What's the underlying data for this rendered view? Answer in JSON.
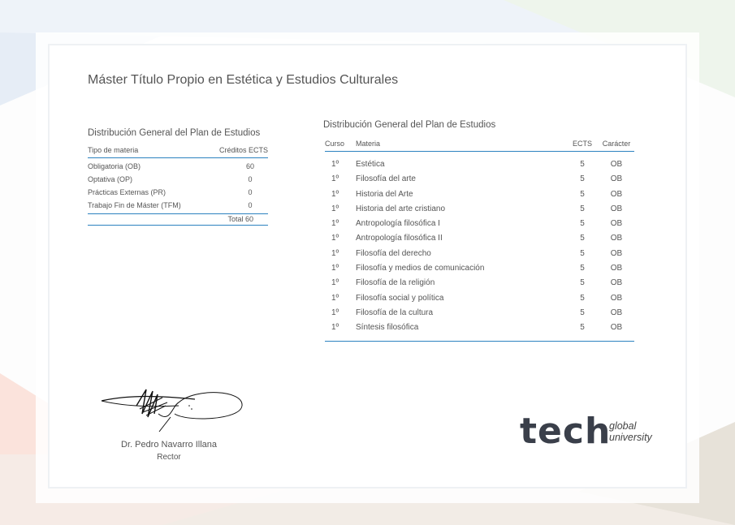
{
  "certificate_title": "Máster Título Propio en Estética y Estudios Culturales",
  "summary": {
    "title": "Distribución General del Plan de Estudios",
    "headers": {
      "type": "Tipo de materia",
      "credits": "Créditos ECTS"
    },
    "rows": [
      {
        "label": "Obligatoria (OB)",
        "value": "60"
      },
      {
        "label": "Optativa (OP)",
        "value": "0"
      },
      {
        "label": "Prácticas Externas (PR)",
        "value": "0"
      },
      {
        "label": "Trabajo Fin de Máster (TFM)",
        "value": "0"
      }
    ],
    "total": "Total 60"
  },
  "detail": {
    "title": "Distribución General del Plan de Estudios",
    "headers": {
      "course": "Curso",
      "subject": "Materia",
      "ects": "ECTS",
      "character": "Carácter"
    },
    "rows": [
      {
        "course": "1º",
        "subject": "Estética",
        "ects": "5",
        "character": "OB"
      },
      {
        "course": "1º",
        "subject": "Filosofía del arte",
        "ects": "5",
        "character": "OB"
      },
      {
        "course": "1º",
        "subject": "Historia del Arte",
        "ects": "5",
        "character": "OB"
      },
      {
        "course": "1º",
        "subject": "Historia del arte cristiano",
        "ects": "5",
        "character": "OB"
      },
      {
        "course": "1º",
        "subject": "Antropología filosófica I",
        "ects": "5",
        "character": "OB"
      },
      {
        "course": "1º",
        "subject": "Antropología filosófica II",
        "ects": "5",
        "character": "OB"
      },
      {
        "course": "1º",
        "subject": "Filosofía del derecho",
        "ects": "5",
        "character": "OB"
      },
      {
        "course": "1º",
        "subject": "Filosofía y medios de comunicación",
        "ects": "5",
        "character": "OB"
      },
      {
        "course": "1º",
        "subject": "Filosofía de la religión",
        "ects": "5",
        "character": "OB"
      },
      {
        "course": "1º",
        "subject": "Filosofía social y política",
        "ects": "5",
        "character": "OB"
      },
      {
        "course": "1º",
        "subject": "Filosofía de la cultura",
        "ects": "5",
        "character": "OB"
      },
      {
        "course": "1º",
        "subject": "Síntesis filosófica",
        "ects": "5",
        "character": "OB"
      }
    ]
  },
  "signature": {
    "name": "Dr. Pedro Navarro Illana",
    "role": "Rector"
  },
  "logo": {
    "brand": "tech",
    "line1": "global",
    "line2": "university"
  },
  "colors": {
    "accent": "#2c82c0",
    "text": "#555555"
  }
}
